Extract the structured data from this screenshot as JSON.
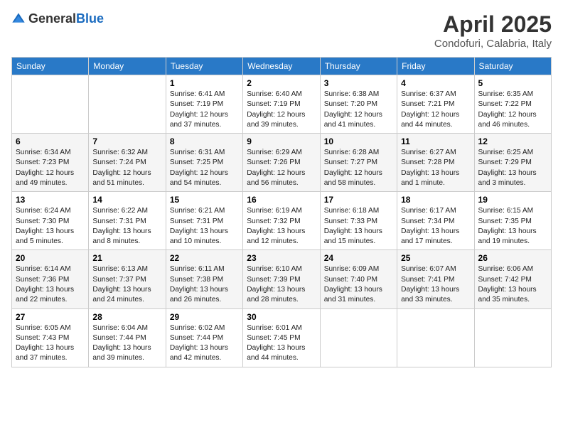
{
  "logo": {
    "general": "General",
    "blue": "Blue"
  },
  "title": "April 2025",
  "location": "Condofuri, Calabria, Italy",
  "weekdays": [
    "Sunday",
    "Monday",
    "Tuesday",
    "Wednesday",
    "Thursday",
    "Friday",
    "Saturday"
  ],
  "weeks": [
    [
      {
        "day": "",
        "sunrise": "",
        "sunset": "",
        "daylight": ""
      },
      {
        "day": "",
        "sunrise": "",
        "sunset": "",
        "daylight": ""
      },
      {
        "day": "1",
        "sunrise": "Sunrise: 6:41 AM",
        "sunset": "Sunset: 7:19 PM",
        "daylight": "Daylight: 12 hours and 37 minutes."
      },
      {
        "day": "2",
        "sunrise": "Sunrise: 6:40 AM",
        "sunset": "Sunset: 7:19 PM",
        "daylight": "Daylight: 12 hours and 39 minutes."
      },
      {
        "day": "3",
        "sunrise": "Sunrise: 6:38 AM",
        "sunset": "Sunset: 7:20 PM",
        "daylight": "Daylight: 12 hours and 41 minutes."
      },
      {
        "day": "4",
        "sunrise": "Sunrise: 6:37 AM",
        "sunset": "Sunset: 7:21 PM",
        "daylight": "Daylight: 12 hours and 44 minutes."
      },
      {
        "day": "5",
        "sunrise": "Sunrise: 6:35 AM",
        "sunset": "Sunset: 7:22 PM",
        "daylight": "Daylight: 12 hours and 46 minutes."
      }
    ],
    [
      {
        "day": "6",
        "sunrise": "Sunrise: 6:34 AM",
        "sunset": "Sunset: 7:23 PM",
        "daylight": "Daylight: 12 hours and 49 minutes."
      },
      {
        "day": "7",
        "sunrise": "Sunrise: 6:32 AM",
        "sunset": "Sunset: 7:24 PM",
        "daylight": "Daylight: 12 hours and 51 minutes."
      },
      {
        "day": "8",
        "sunrise": "Sunrise: 6:31 AM",
        "sunset": "Sunset: 7:25 PM",
        "daylight": "Daylight: 12 hours and 54 minutes."
      },
      {
        "day": "9",
        "sunrise": "Sunrise: 6:29 AM",
        "sunset": "Sunset: 7:26 PM",
        "daylight": "Daylight: 12 hours and 56 minutes."
      },
      {
        "day": "10",
        "sunrise": "Sunrise: 6:28 AM",
        "sunset": "Sunset: 7:27 PM",
        "daylight": "Daylight: 12 hours and 58 minutes."
      },
      {
        "day": "11",
        "sunrise": "Sunrise: 6:27 AM",
        "sunset": "Sunset: 7:28 PM",
        "daylight": "Daylight: 13 hours and 1 minute."
      },
      {
        "day": "12",
        "sunrise": "Sunrise: 6:25 AM",
        "sunset": "Sunset: 7:29 PM",
        "daylight": "Daylight: 13 hours and 3 minutes."
      }
    ],
    [
      {
        "day": "13",
        "sunrise": "Sunrise: 6:24 AM",
        "sunset": "Sunset: 7:30 PM",
        "daylight": "Daylight: 13 hours and 5 minutes."
      },
      {
        "day": "14",
        "sunrise": "Sunrise: 6:22 AM",
        "sunset": "Sunset: 7:31 PM",
        "daylight": "Daylight: 13 hours and 8 minutes."
      },
      {
        "day": "15",
        "sunrise": "Sunrise: 6:21 AM",
        "sunset": "Sunset: 7:31 PM",
        "daylight": "Daylight: 13 hours and 10 minutes."
      },
      {
        "day": "16",
        "sunrise": "Sunrise: 6:19 AM",
        "sunset": "Sunset: 7:32 PM",
        "daylight": "Daylight: 13 hours and 12 minutes."
      },
      {
        "day": "17",
        "sunrise": "Sunrise: 6:18 AM",
        "sunset": "Sunset: 7:33 PM",
        "daylight": "Daylight: 13 hours and 15 minutes."
      },
      {
        "day": "18",
        "sunrise": "Sunrise: 6:17 AM",
        "sunset": "Sunset: 7:34 PM",
        "daylight": "Daylight: 13 hours and 17 minutes."
      },
      {
        "day": "19",
        "sunrise": "Sunrise: 6:15 AM",
        "sunset": "Sunset: 7:35 PM",
        "daylight": "Daylight: 13 hours and 19 minutes."
      }
    ],
    [
      {
        "day": "20",
        "sunrise": "Sunrise: 6:14 AM",
        "sunset": "Sunset: 7:36 PM",
        "daylight": "Daylight: 13 hours and 22 minutes."
      },
      {
        "day": "21",
        "sunrise": "Sunrise: 6:13 AM",
        "sunset": "Sunset: 7:37 PM",
        "daylight": "Daylight: 13 hours and 24 minutes."
      },
      {
        "day": "22",
        "sunrise": "Sunrise: 6:11 AM",
        "sunset": "Sunset: 7:38 PM",
        "daylight": "Daylight: 13 hours and 26 minutes."
      },
      {
        "day": "23",
        "sunrise": "Sunrise: 6:10 AM",
        "sunset": "Sunset: 7:39 PM",
        "daylight": "Daylight: 13 hours and 28 minutes."
      },
      {
        "day": "24",
        "sunrise": "Sunrise: 6:09 AM",
        "sunset": "Sunset: 7:40 PM",
        "daylight": "Daylight: 13 hours and 31 minutes."
      },
      {
        "day": "25",
        "sunrise": "Sunrise: 6:07 AM",
        "sunset": "Sunset: 7:41 PM",
        "daylight": "Daylight: 13 hours and 33 minutes."
      },
      {
        "day": "26",
        "sunrise": "Sunrise: 6:06 AM",
        "sunset": "Sunset: 7:42 PM",
        "daylight": "Daylight: 13 hours and 35 minutes."
      }
    ],
    [
      {
        "day": "27",
        "sunrise": "Sunrise: 6:05 AM",
        "sunset": "Sunset: 7:43 PM",
        "daylight": "Daylight: 13 hours and 37 minutes."
      },
      {
        "day": "28",
        "sunrise": "Sunrise: 6:04 AM",
        "sunset": "Sunset: 7:44 PM",
        "daylight": "Daylight: 13 hours and 39 minutes."
      },
      {
        "day": "29",
        "sunrise": "Sunrise: 6:02 AM",
        "sunset": "Sunset: 7:44 PM",
        "daylight": "Daylight: 13 hours and 42 minutes."
      },
      {
        "day": "30",
        "sunrise": "Sunrise: 6:01 AM",
        "sunset": "Sunset: 7:45 PM",
        "daylight": "Daylight: 13 hours and 44 minutes."
      },
      {
        "day": "",
        "sunrise": "",
        "sunset": "",
        "daylight": ""
      },
      {
        "day": "",
        "sunrise": "",
        "sunset": "",
        "daylight": ""
      },
      {
        "day": "",
        "sunrise": "",
        "sunset": "",
        "daylight": ""
      }
    ]
  ]
}
